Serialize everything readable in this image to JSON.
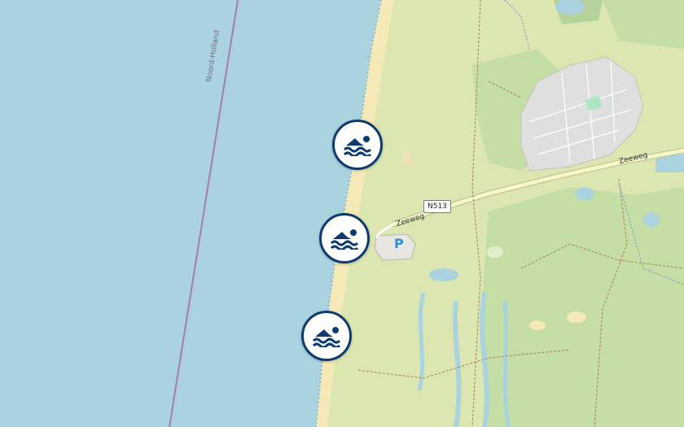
{
  "map": {
    "colors": {
      "sea": "#aad3df",
      "beach": "#f5e9b8",
      "dunes": "#dbe6b0",
      "forest": "#c4dea6",
      "town": "#e0dfdf",
      "road": "#f7f7c4",
      "boundary": "#9e7fa8",
      "marker_border": "#0d3b70"
    },
    "labels": {
      "province": "Noord-Holland",
      "road_number": "N513",
      "road_name_1": "Zeeweg",
      "road_name_2": "Zeeweg",
      "parking": "P"
    },
    "markers": [
      {
        "type": "swimming",
        "icon": "swimmer-icon"
      },
      {
        "type": "swimming",
        "icon": "swimmer-icon"
      },
      {
        "type": "swimming",
        "icon": "swimmer-icon"
      }
    ]
  }
}
